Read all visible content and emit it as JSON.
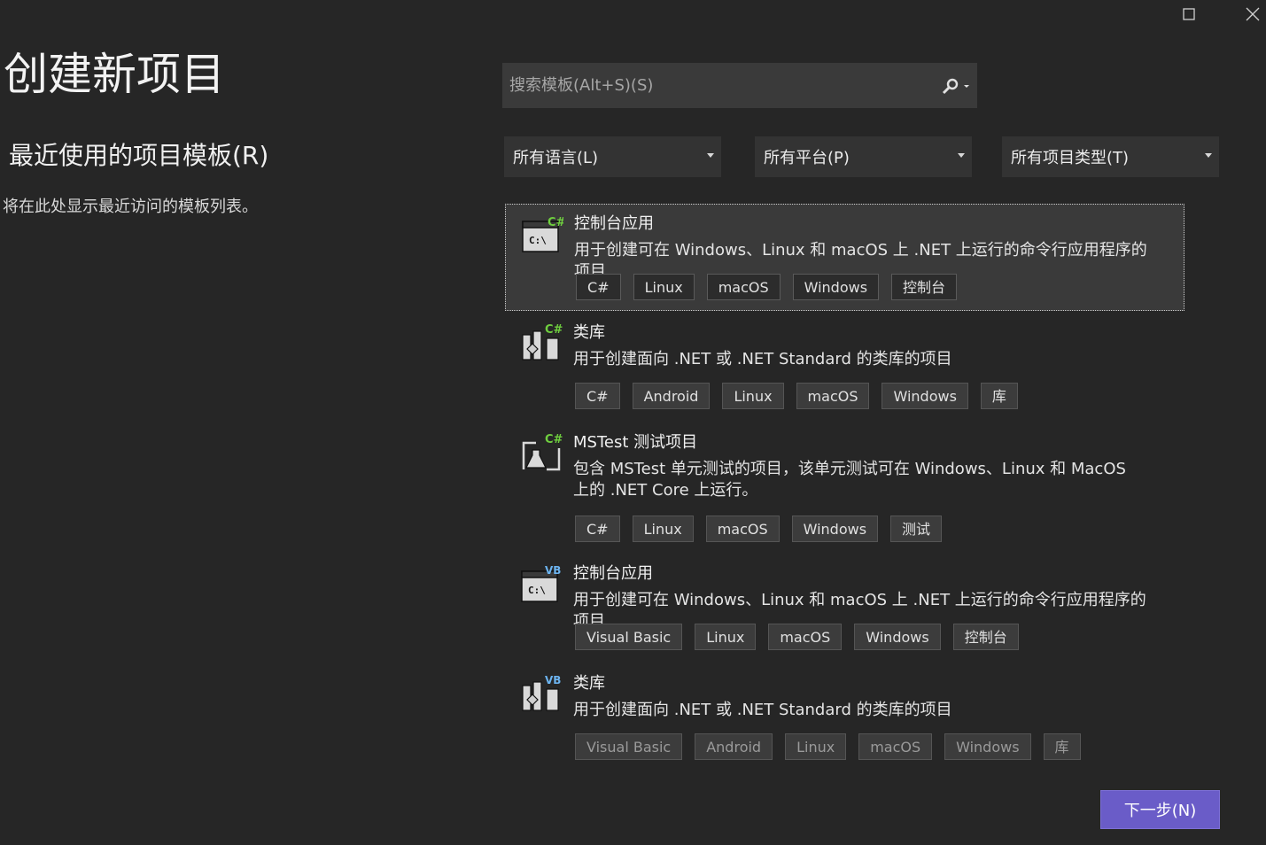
{
  "window_controls": {
    "maximize_icon": "maximize-icon",
    "close_icon": "close-icon"
  },
  "page_title": "创建新项目",
  "recent": {
    "title": "最近使用的项目模板(R)",
    "empty_text": "将在此处显示最近访问的模板列表。"
  },
  "search": {
    "placeholder": "搜索模板(Alt+S)(S)",
    "icon": "search-icon"
  },
  "filters": {
    "language": "所有语言(L)",
    "platform": "所有平台(P)",
    "project_type": "所有项目类型(T)"
  },
  "templates": [
    {
      "name": "控制台应用",
      "lang_badge": "C#",
      "icon": "console-app-icon",
      "description": "用于创建可在 Windows、Linux 和 macOS 上 .NET 上运行的命令行应用程序的项目",
      "tags": [
        "C#",
        "Linux",
        "macOS",
        "Windows",
        "控制台"
      ]
    },
    {
      "name": "类库",
      "lang_badge": "C#",
      "icon": "class-library-icon",
      "description": "用于创建面向 .NET 或 .NET Standard 的类库的项目",
      "tags": [
        "C#",
        "Android",
        "Linux",
        "macOS",
        "Windows",
        "库"
      ]
    },
    {
      "name": "MSTest 测试项目",
      "lang_badge": "C#",
      "icon": "test-project-icon",
      "description": "包含 MSTest 单元测试的项目，该单元测试可在 Windows、Linux 和 MacOS 上的 .NET Core 上运行。",
      "tags": [
        "C#",
        "Linux",
        "macOS",
        "Windows",
        "测试"
      ]
    },
    {
      "name": "控制台应用",
      "lang_badge": "VB",
      "icon": "console-app-icon",
      "description": "用于创建可在 Windows、Linux 和 macOS 上 .NET 上运行的命令行应用程序的项目",
      "tags": [
        "Visual Basic",
        "Linux",
        "macOS",
        "Windows",
        "控制台"
      ]
    },
    {
      "name": "类库",
      "lang_badge": "VB",
      "icon": "class-library-icon",
      "description": "用于创建面向 .NET 或 .NET Standard 的类库的项目",
      "tags": [
        "Visual Basic",
        "Android",
        "Linux",
        "macOS",
        "Windows",
        "库"
      ]
    }
  ],
  "next_button": "下一步(N)",
  "colors": {
    "background": "#262626",
    "accent": "#6a5cc8",
    "csharp_badge": "#6fcf3f",
    "vb_badge": "#6cb4f0"
  }
}
